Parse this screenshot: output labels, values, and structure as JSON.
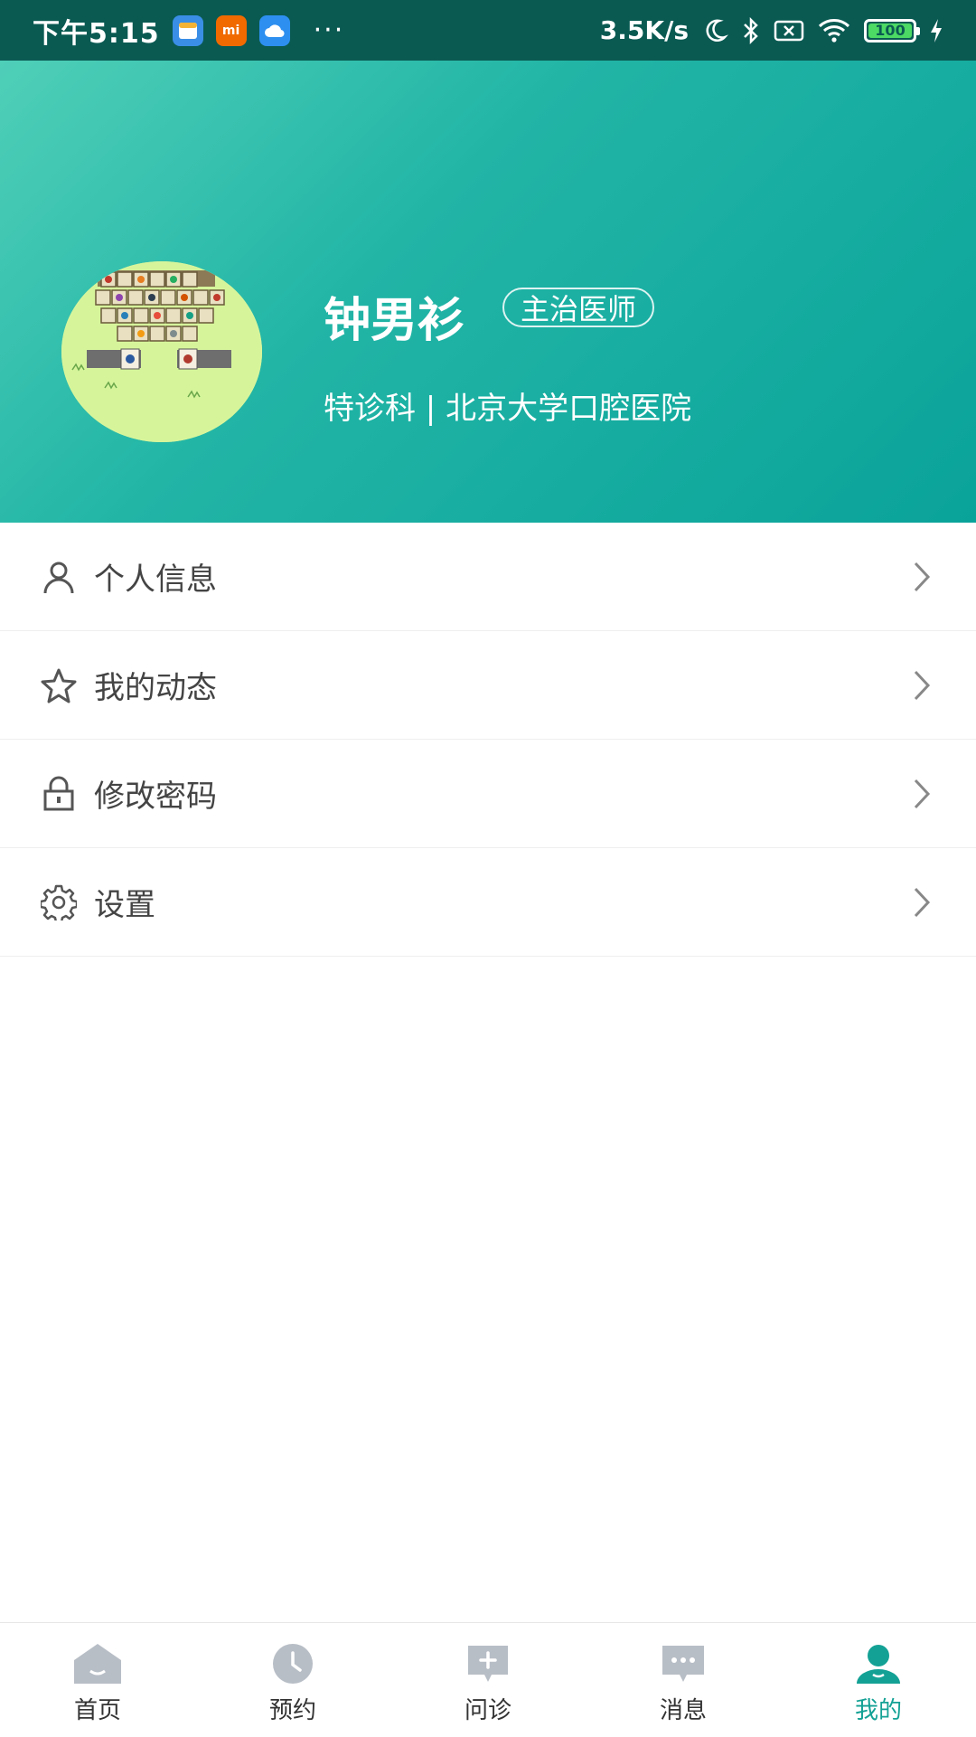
{
  "status_bar": {
    "time": "下午5:15",
    "more": "···",
    "network_speed": "3.5K/s",
    "battery": "100",
    "app_icons": [
      "calendar-app-icon",
      "mi-app-icon",
      "cloud-app-icon"
    ],
    "mi_label": "mi"
  },
  "profile": {
    "name": "钟男衫",
    "title": "主治医师",
    "department_hospital": "特诊科 | 北京大学口腔医院"
  },
  "menu": {
    "items": [
      {
        "label": "个人信息",
        "icon": "user-icon"
      },
      {
        "label": "我的动态",
        "icon": "star-icon"
      },
      {
        "label": "修改密码",
        "icon": "lock-icon"
      },
      {
        "label": "设置",
        "icon": "gear-icon"
      }
    ]
  },
  "bottom_nav": {
    "items": [
      {
        "label": "首页",
        "icon": "home-icon"
      },
      {
        "label": "预约",
        "icon": "clock-icon"
      },
      {
        "label": "问诊",
        "icon": "consult-icon"
      },
      {
        "label": "消息",
        "icon": "message-icon"
      },
      {
        "label": "我的",
        "icon": "profile-icon"
      }
    ],
    "active_index": 4
  },
  "colors": {
    "accent": "#14a195",
    "status_bar": "#0a5a52",
    "header_start": "#4fcfb8",
    "header_end": "#0aa39a",
    "inactive_icon": "#b8bec6"
  }
}
